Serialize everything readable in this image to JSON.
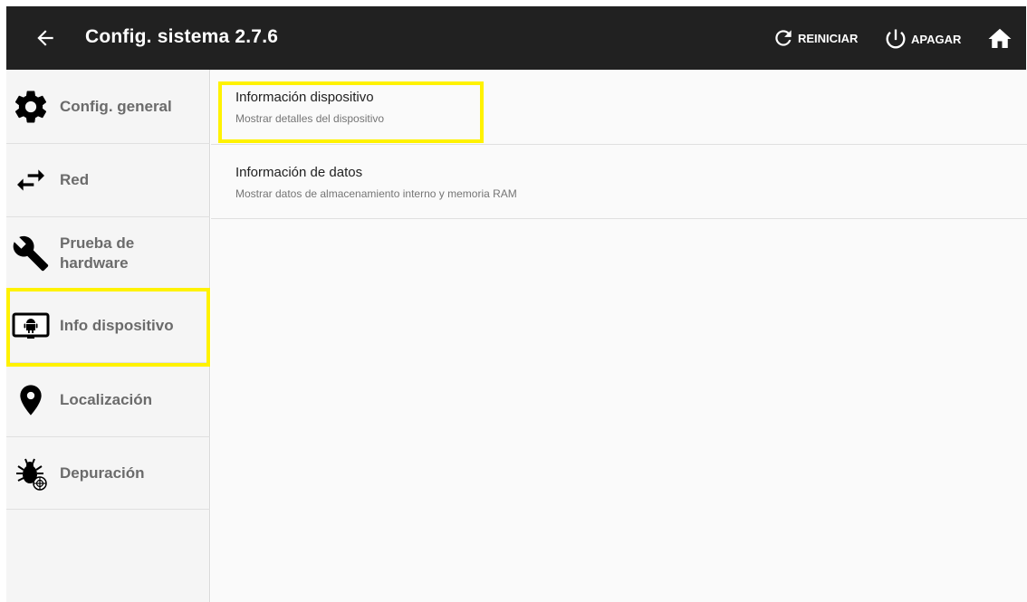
{
  "header": {
    "title": "Config. sistema 2.7.6",
    "back_icon": "arrow-left-icon",
    "restart_label": "REINICIAR",
    "shutdown_label": "APAGAR",
    "home_icon": "home-icon"
  },
  "sidebar": {
    "items": [
      {
        "label": "Config. general",
        "icon": "gear-icon"
      },
      {
        "label": "Red",
        "icon": "swap-arrows-icon"
      },
      {
        "label": "Prueba de hardware",
        "icon": "wrench-icon"
      },
      {
        "label": "Info dispositivo",
        "icon": "device-info-icon",
        "selected": true
      },
      {
        "label": "Localización",
        "icon": "location-pin-icon"
      },
      {
        "label": "Depuración",
        "icon": "bug-icon"
      }
    ]
  },
  "main": {
    "items": [
      {
        "title": "Información dispositivo",
        "subtitle": "Mostrar detalles del dispositivo"
      },
      {
        "title": "Información de datos",
        "subtitle": "Mostrar datos de almacenamiento interno y memoria RAM"
      }
    ]
  },
  "colors": {
    "topbar": "#212121",
    "highlight": "#fff200",
    "sidebar_text": "#6b6b6b"
  }
}
